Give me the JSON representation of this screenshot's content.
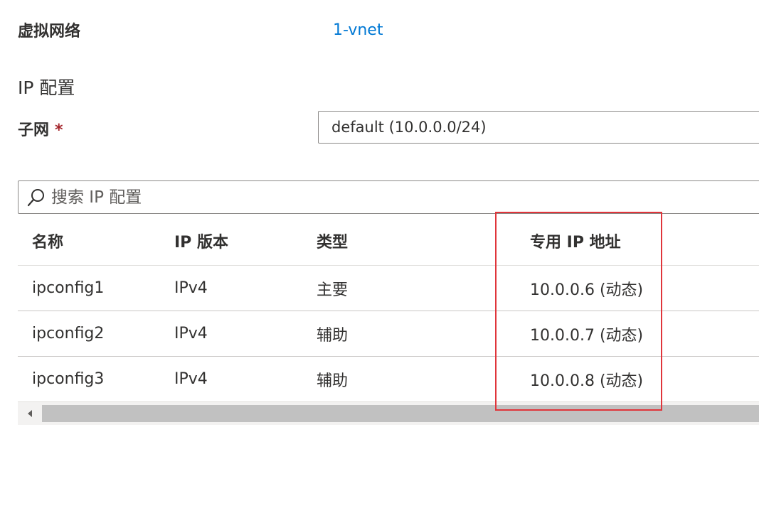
{
  "vnet": {
    "label": "虚拟网络",
    "link": "1-vnet"
  },
  "ip_config": {
    "heading": "IP 配置"
  },
  "subnet": {
    "label": "子网",
    "required_marker": "*",
    "value": "default (10.0.0.0/24)"
  },
  "search": {
    "placeholder": "搜索 IP 配置",
    "icon": "search-icon"
  },
  "table": {
    "headers": [
      "名称",
      "IP 版本",
      "类型",
      "专用 IP 地址"
    ],
    "rows": [
      [
        "ipconfig1",
        "IPv4",
        "主要",
        "10.0.0.6 (动态)"
      ],
      [
        "ipconfig2",
        "IPv4",
        "辅助",
        "10.0.0.7 (动态)"
      ],
      [
        "ipconfig3",
        "IPv4",
        "辅助",
        "10.0.0.8 (动态)"
      ]
    ]
  },
  "scrollbar": {
    "left_arrow_icon": "chevron-left-icon"
  },
  "colors": {
    "link": "#0078d4",
    "required": "#a4262c",
    "highlight": "#e0353b"
  }
}
